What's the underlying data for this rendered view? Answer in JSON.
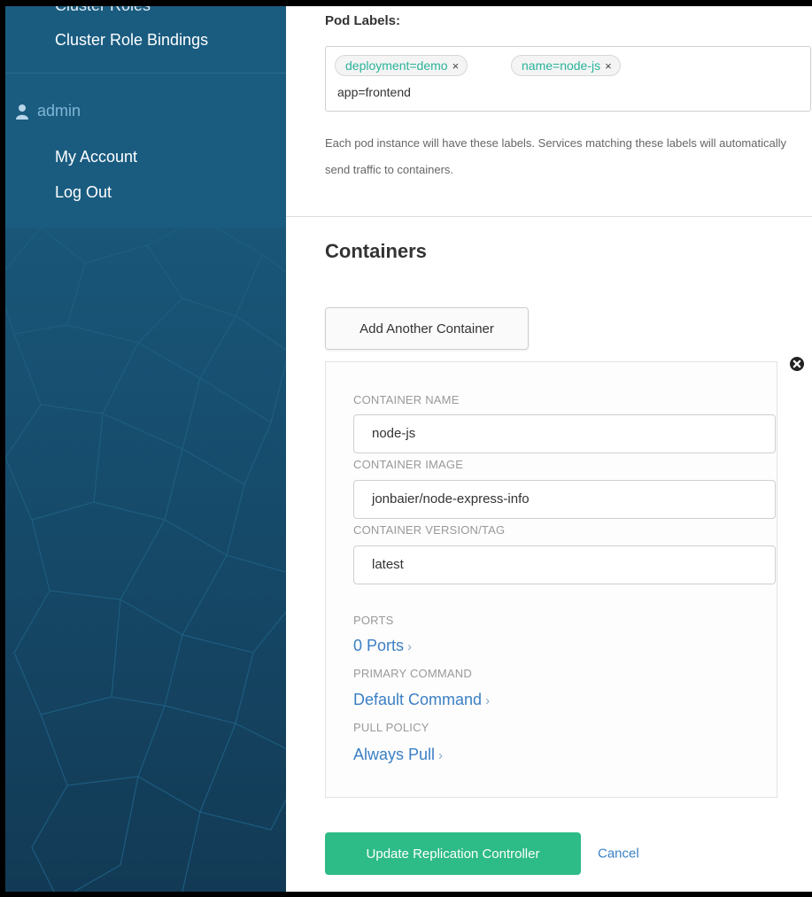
{
  "sidebar": {
    "cut_item": "Cluster Roles",
    "items": [
      "Cluster Role Bindings"
    ],
    "user": {
      "icon": "user-icon",
      "name": "admin",
      "links": [
        "My Account",
        "Log Out"
      ]
    }
  },
  "pod_labels": {
    "title": "Pod Labels:",
    "tags": [
      {
        "label": "deployment=demo",
        "remove": "×"
      },
      {
        "label": "name=node-js",
        "remove": "×"
      }
    ],
    "input_value": "app=frontend",
    "help": "Each pod instance will have these labels. Services matching these labels will automatically send traffic to containers."
  },
  "containers": {
    "title": "Containers",
    "add_label": "Add Another Container",
    "remove_icon": "close-circle-icon",
    "card": {
      "name_label": "CONTAINER NAME",
      "name_value": "node-js",
      "image_label": "CONTAINER IMAGE",
      "image_value": "jonbaier/node-express-info",
      "version_label": "CONTAINER VERSION/TAG",
      "version_value": "latest",
      "ports_label": "PORTS",
      "ports_link": "0 Ports",
      "command_label": "PRIMARY COMMAND",
      "command_link": "Default Command",
      "pull_label": "PULL POLICY",
      "pull_link": "Always Pull",
      "chevron": "›"
    }
  },
  "actions": {
    "submit": "Update Replication Controller",
    "cancel": "Cancel"
  },
  "colors": {
    "sidebar": "#1a5c80",
    "accent_green": "#2dbb87",
    "link_blue": "#3b7fc4",
    "tag_text": "#2bb39a"
  }
}
